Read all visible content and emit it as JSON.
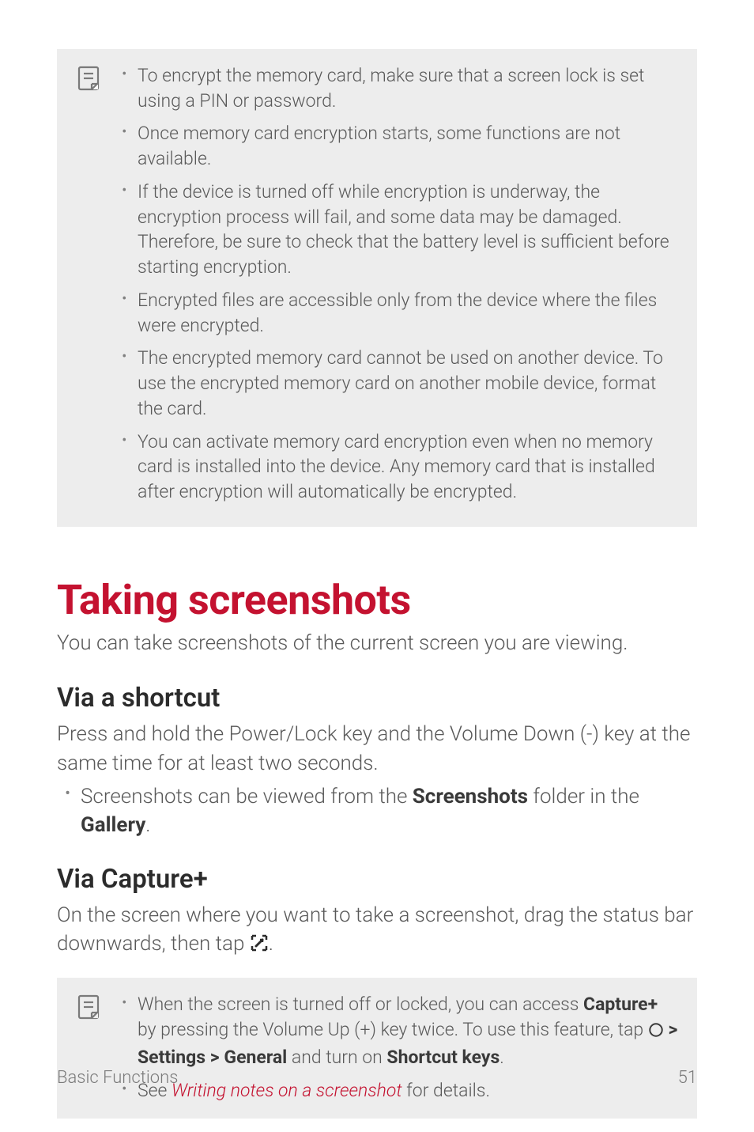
{
  "note1": {
    "items": [
      "To encrypt the memory card, make sure that a screen lock is set using a PIN or password.",
      "Once memory card encryption starts, some functions are not available.",
      "If the device is turned off while encryption is underway, the encryption process will fail, and some data may be damaged. Therefore, be sure to check that the battery level is sufficient before starting encryption.",
      "Encrypted files are accessible only from the device where the files were encrypted.",
      "The encrypted memory card cannot be used on another device. To use the encrypted memory card on another mobile device, format the card.",
      "You can activate memory card encryption even when no memory card is installed into the device. Any memory card that is installed after encryption will automatically be encrypted."
    ]
  },
  "section": {
    "heading": "Taking screenshots",
    "intro": "You can take screenshots of the current screen you are viewing."
  },
  "shortcut": {
    "heading": "Via a shortcut",
    "para": "Press and hold the Power/Lock key and the Volume Down (-) key at the same time for at least two seconds.",
    "list_pre": "Screenshots can be viewed from the ",
    "list_bold1": "Screenshots",
    "list_mid": " folder in the ",
    "list_bold2": "Gallery",
    "list_post": "."
  },
  "capture": {
    "heading": "Via Capture+",
    "para_pre": "On the screen where you want to take a screenshot, drag the status bar downwards, then tap ",
    "para_post": "."
  },
  "note2": {
    "item1_pre": "When the screen is turned off or locked, you can access ",
    "item1_bold1": "Capture+",
    "item1_mid1": " by pressing the Volume Up (+) key twice. To use this feature, tap ",
    "item1_bold2": "Settings",
    "item1_gt": " > ",
    "item1_bold3": "General",
    "item1_mid2": " and turn on ",
    "item1_bold4": "Shortcut keys",
    "item1_post": ".",
    "item2_pre": "See ",
    "item2_link": "Writing notes on a screenshot",
    "item2_post": " for details."
  },
  "footer": {
    "left": "Basic Functions",
    "right": "51"
  }
}
